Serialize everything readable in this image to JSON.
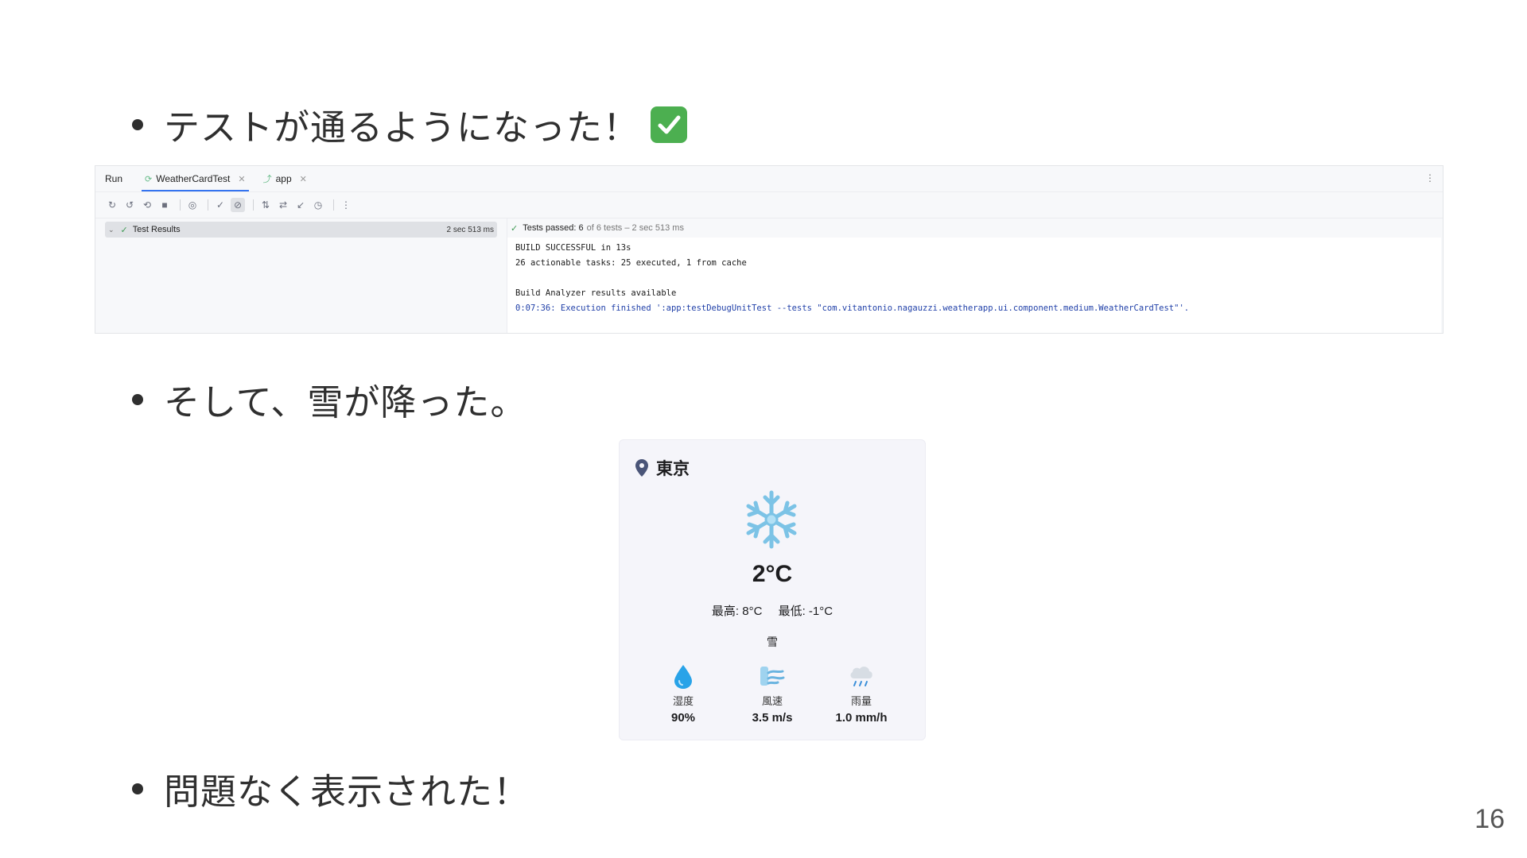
{
  "bullets": {
    "first": "テストが通るようになった！",
    "second": "そして、雪が降った。",
    "third": "問題なく表示された！"
  },
  "ide": {
    "run_label": "Run",
    "tabs": [
      {
        "label": "WeatherCardTest",
        "icon": "test-icon"
      },
      {
        "label": "app",
        "icon": "gradle-icon"
      }
    ],
    "tree": {
      "label": "Test Results",
      "duration": "2 sec 513 ms"
    },
    "pass_summary": {
      "passed": "Tests passed: 6",
      "detail": "of 6 tests – 2 sec 513 ms"
    },
    "console_lines": [
      "BUILD SUCCESSFUL in 13s",
      "26 actionable tasks: 25 executed, 1 from cache",
      "",
      "Build Analyzer results available",
      "0:07:36: Execution finished ':app:testDebugUnitTest --tests \"com.vitantonio.nagauzzi.weatherapp.ui.component.medium.WeatherCardTest\"'."
    ]
  },
  "card": {
    "city": "東京",
    "temperature": "2°C",
    "high": "最高: 8°C",
    "low": "最低: -1°C",
    "condition": "雪",
    "stats": [
      {
        "label": "湿度",
        "value": "90%",
        "icon": "droplet-icon"
      },
      {
        "label": "風速",
        "value": "3.5 m/s",
        "icon": "wind-icon"
      },
      {
        "label": "雨量",
        "value": "1.0 mm/h",
        "icon": "rain-cloud-icon"
      }
    ]
  },
  "page_number": "16"
}
